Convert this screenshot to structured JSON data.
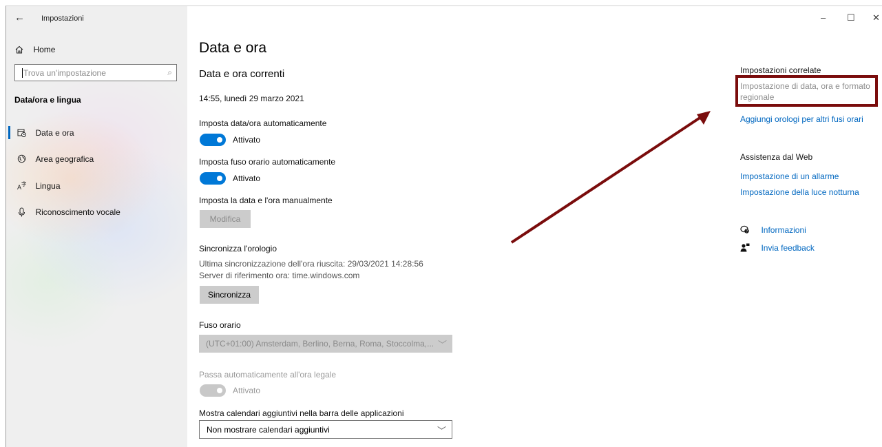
{
  "window": {
    "title": "Impostazioni",
    "back_icon": "←",
    "minimize_icon": "–",
    "maximize_icon": "☐",
    "close_icon": "✕"
  },
  "sidebar": {
    "home_label": "Home",
    "search_placeholder": "Trova un'impostazione",
    "section_title": "Data/ora e lingua",
    "items": [
      {
        "label": "Data e ora",
        "icon": "calendar-clock-icon",
        "active": true
      },
      {
        "label": "Area geografica",
        "icon": "globe-icon",
        "active": false
      },
      {
        "label": "Lingua",
        "icon": "language-icon",
        "active": false
      },
      {
        "label": "Riconoscimento vocale",
        "icon": "microphone-icon",
        "active": false
      }
    ]
  },
  "main": {
    "title": "Data e ora",
    "current_heading": "Data e ora correnti",
    "current_datetime": "14:55, lunedì 29 marzo 2021",
    "auto_time_label": "Imposta data/ora automaticamente",
    "auto_time_state": "Attivato",
    "auto_tz_label": "Imposta fuso orario automaticamente",
    "auto_tz_state": "Attivato",
    "manual_label": "Imposta la data e l'ora manualmente",
    "modify_button": "Modifica",
    "sync_heading": "Sincronizza l'orologio",
    "sync_last": "Ultima sincronizzazione dell'ora riuscita: 29/03/2021 14:28:56",
    "sync_server": "Server di riferimento ora: time.windows.com",
    "sync_button": "Sincronizza",
    "timezone_label": "Fuso orario",
    "timezone_value": "(UTC+01:00) Amsterdam, Berlino, Berna, Roma, Stoccolma,...",
    "dst_label": "Passa automaticamente all'ora legale",
    "dst_state": "Attivato",
    "calendars_label": "Mostra calendari aggiuntivi nella barra delle applicazioni",
    "calendars_value": "Non mostrare calendari aggiuntivi"
  },
  "related": {
    "heading": "Impostazioni correlate",
    "regional_link_line1": "Impostazione di data, ora e formato",
    "regional_link_line2": "regionale",
    "clocks_link": "Aggiungi orologi per altri fusi orari",
    "web_heading": "Assistenza dal Web",
    "alarm_link": "Impostazione di un allarme",
    "nightlight_link": "Impostazione della luce notturna",
    "info_link": "Informazioni",
    "feedback_link": "Invia feedback"
  },
  "colors": {
    "accent": "#0078d7",
    "link": "#0067c0",
    "annotation": "#7a0c0c"
  }
}
